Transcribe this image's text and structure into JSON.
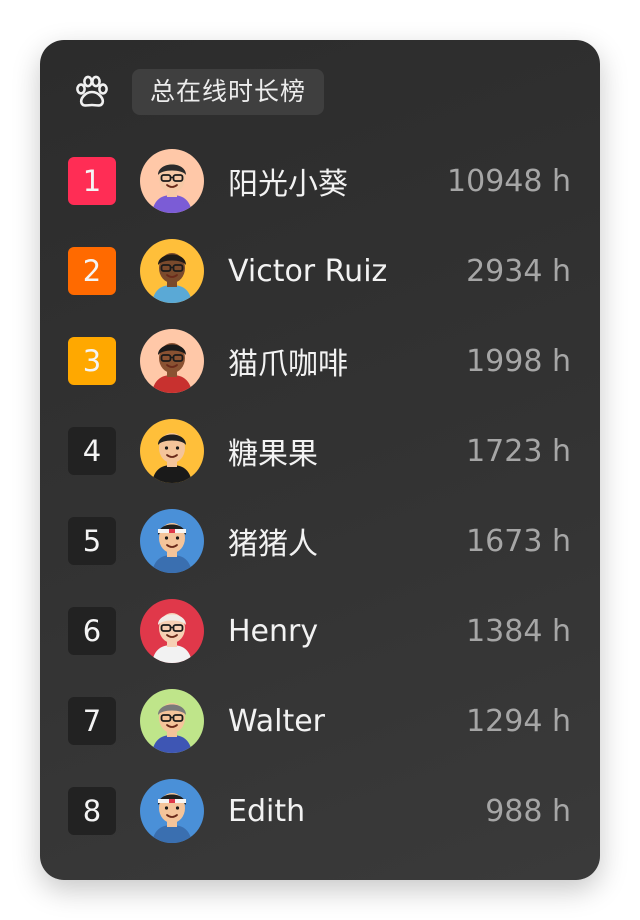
{
  "header": {
    "icon": "paw-print-icon",
    "title": "总在线时长榜"
  },
  "rank_colors": {
    "first": "#ff2d55",
    "second": "#ff6a00",
    "third": "#ffa800",
    "default": "#222222"
  },
  "leaderboard": [
    {
      "rank": "1",
      "name": "阳光小葵",
      "hours": "10948 h",
      "avatar_bg": "#ffc8a8"
    },
    {
      "rank": "2",
      "name": "Victor Ruiz",
      "hours": "2934 h",
      "avatar_bg": "#ffbf3a"
    },
    {
      "rank": "3",
      "name": "猫爪咖啡",
      "hours": "1998 h",
      "avatar_bg": "#ffc8a8"
    },
    {
      "rank": "4",
      "name": "糖果果",
      "hours": "1723 h",
      "avatar_bg": "#ffbf3a"
    },
    {
      "rank": "5",
      "name": "猪猪人",
      "hours": "1673 h",
      "avatar_bg": "#4a90d8"
    },
    {
      "rank": "6",
      "name": "Henry",
      "hours": "1384 h",
      "avatar_bg": "#e0384a"
    },
    {
      "rank": "7",
      "name": "Walter",
      "hours": "1294 h",
      "avatar_bg": "#bfe58a"
    },
    {
      "rank": "8",
      "name": "Edith",
      "hours": "988 h",
      "avatar_bg": "#4a90d8"
    }
  ]
}
